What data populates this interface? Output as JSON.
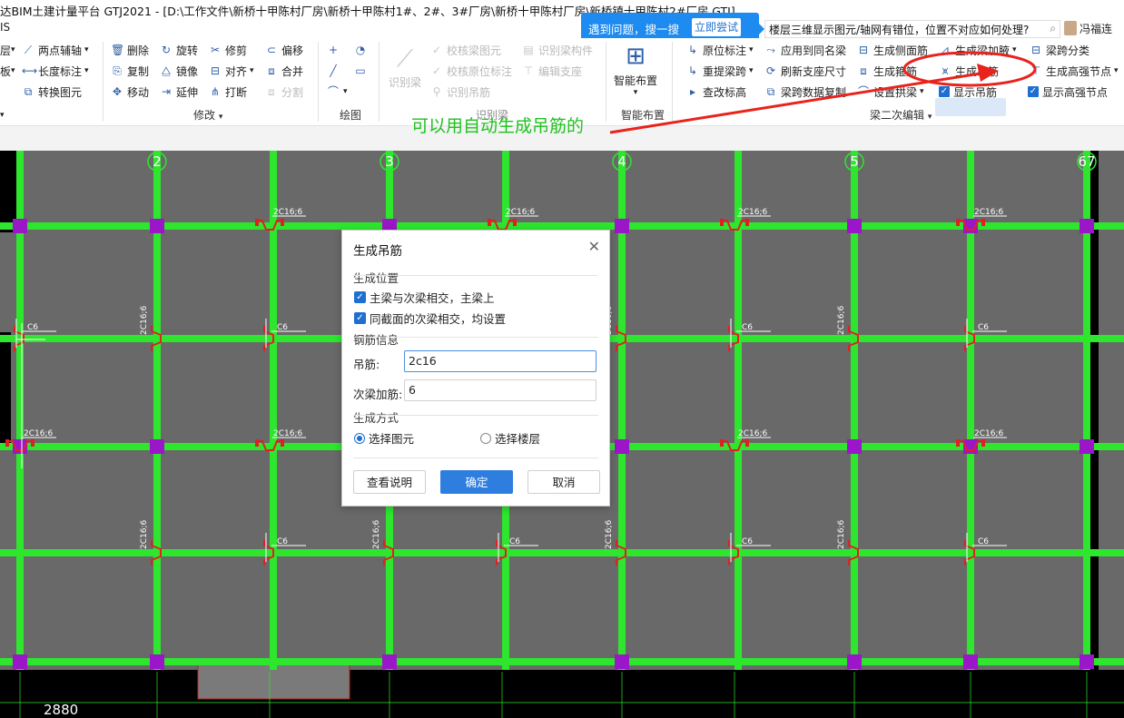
{
  "window": {
    "title": "达BIM土建计量平台 GTJ2021 - [D:\\工作文件\\新桥十甲陈村厂房\\新桥十甲陈村1#、2#、3#厂房\\新桥十甲陈村厂房\\新桥镇十甲陈村2#厂房.GTJ]",
    "subtitle": "IS"
  },
  "help": {
    "question": "遇到问题，搜一搜",
    "try_button": "立即尝试"
  },
  "search": {
    "text": "楼层三维显示图元/轴网有错位，位置不对应如何处理?"
  },
  "user": {
    "name": "冯福连"
  },
  "ribbon": {
    "left_partial": [
      "层",
      "板",
      ""
    ],
    "col_aux": {
      "two_point_axis": "两点辅轴",
      "length_dim": "长度标注",
      "convert": "转换图元"
    },
    "modify": {
      "delete": "删除",
      "copy": "复制",
      "move": "移动",
      "rotate": "旋转",
      "mirror": "镜像",
      "extend": "延伸",
      "trim": "修剪",
      "align": "对齐",
      "break": "打断",
      "offset": "偏移",
      "merge": "合并",
      "split": "分割",
      "group_label": "修改"
    },
    "draw": {
      "group_label": "绘图"
    },
    "identify": {
      "big_button": "识别梁",
      "check_beam": "校核梁图元",
      "check_origin": "校核原位标注",
      "identify_hanger": "识别吊筋",
      "identify_member": "识别梁构件",
      "edit_support": "编辑支座",
      "group_label": "识别梁"
    },
    "smart": {
      "big_button": "智能布置",
      "group_label": "智能布置"
    },
    "beam_secondary": {
      "original_mark": "原位标注",
      "reextract_span": "重提梁跨",
      "check_elevation": "查改标高",
      "apply_same": "应用到同名梁",
      "refresh_support": "刷新支座尺寸",
      "beam_data_copy": "梁跨数据复制",
      "gen_side_rebar": "生成侧面筋",
      "gen_stirrup": "生成箍筋",
      "set_arch": "设置拱梁",
      "gen_beam_haunch": "生成梁加腋",
      "gen_hanger": "生成吊筋",
      "show_hanger": "显示吊筋",
      "span_classify": "梁跨分类",
      "gen_strong_node": "生成高强节点",
      "show_strong_node": "显示高强节点",
      "group_label": "梁二次编辑"
    }
  },
  "annotation": {
    "text": "可以用自动生成吊筋的"
  },
  "canvas": {
    "axis_labels": [
      "2",
      "3",
      "4",
      "5",
      "67"
    ],
    "rebar_label": "2C16;6",
    "rebar_short": "C6",
    "rebar_vertical": "2C16;6",
    "dimension": "2880"
  },
  "dialog": {
    "title": "生成吊筋",
    "section_position": "生成位置",
    "opt_main_secondary": "主梁与次梁相交，主梁上",
    "opt_same_section": "同截面的次梁相交，均设置",
    "section_rebar": "钢筋信息",
    "hanger_label": "吊筋:",
    "hanger_value": "2c16",
    "secondary_label": "次梁加筋:",
    "secondary_value": "6",
    "section_method": "生成方式",
    "method_select_element": "选择图元",
    "method_select_floor": "选择楼层",
    "btn_help": "查看说明",
    "btn_ok": "确定",
    "btn_cancel": "取消"
  },
  "colors": {
    "beam": "#2ee62e",
    "background": "#696969",
    "column": "#9a16c8",
    "accent": "#1e8bf0",
    "annotation_arrow": "#e8231c"
  }
}
